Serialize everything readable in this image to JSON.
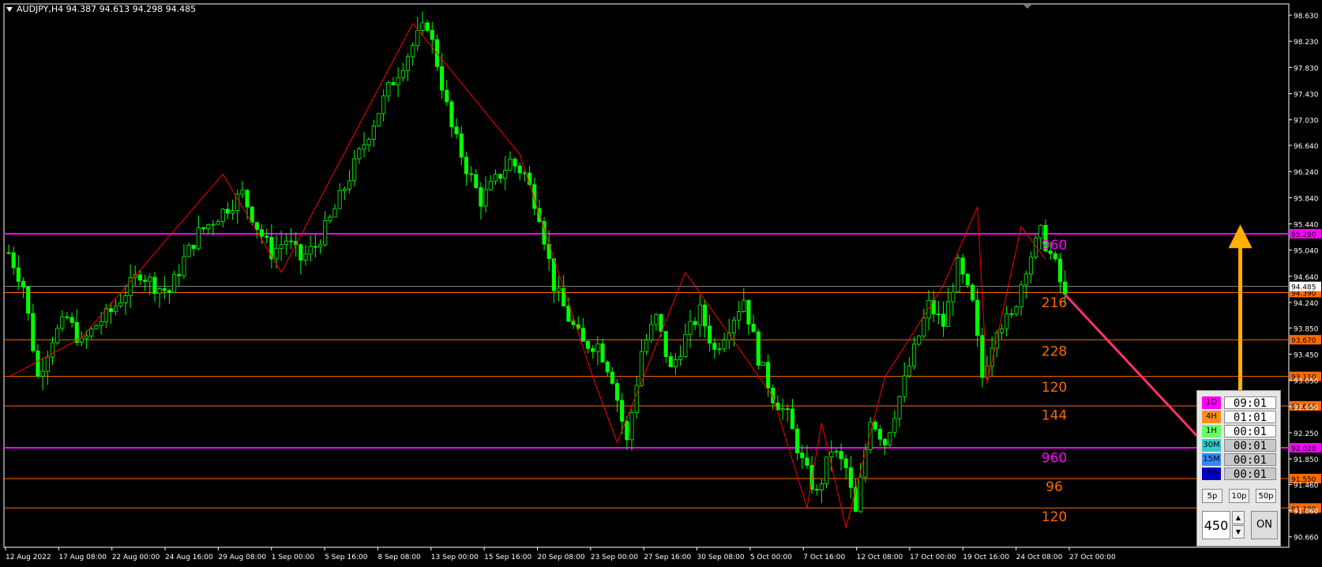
{
  "header": {
    "title": "AUDJPY,H4  94.387 94.613 94.298 94.485"
  },
  "colors": {
    "bull": "#00ff00",
    "bear": "#00ff00",
    "magenta": "#ff00ff",
    "orange": "#ff6a00",
    "zigzag": "#ff0000",
    "pink_arrow": "#ff3070",
    "gold_arrow": "#ffb000",
    "current": "#8a8a8a"
  },
  "chart_data": {
    "type": "candlestick",
    "symbol": "AUDJPY",
    "timeframe": "H4",
    "ylim": [
      90.5,
      98.8
    ],
    "y_ticks": [
      "98.630",
      "98.230",
      "97.830",
      "97.430",
      "97.030",
      "96.640",
      "96.240",
      "95.840",
      "95.440",
      "95.040",
      "94.640",
      "94.240",
      "93.850",
      "93.450",
      "93.050",
      "92.650",
      "92.250",
      "91.850",
      "91.460",
      "91.060",
      "90.660"
    ],
    "x_ticks": [
      "12 Aug 2022",
      "17 Aug 08:00",
      "22 Aug 00:00",
      "24 Aug 16:00",
      "29 Aug 08:00",
      "1 Sep 00:00",
      "5 Sep 16:00",
      "8 Sep 08:00",
      "13 Sep 00:00",
      "15 Sep 16:00",
      "20 Sep 08:00",
      "23 Sep 00:00",
      "27 Sep 16:00",
      "30 Sep 08:00",
      "5 Oct 00:00",
      "7 Oct 16:00",
      "12 Oct 08:00",
      "17 Oct 00:00",
      "19 Oct 16:00",
      "24 Oct 08:00",
      "27 Oct 00:00"
    ],
    "close_path": [
      [
        0,
        95.0
      ],
      [
        3,
        94.5
      ],
      [
        6,
        93.1
      ],
      [
        9,
        93.7
      ],
      [
        12,
        94.0
      ],
      [
        15,
        93.6
      ],
      [
        18,
        93.9
      ],
      [
        21,
        94.1
      ],
      [
        24,
        94.4
      ],
      [
        27,
        94.7
      ],
      [
        30,
        94.5
      ],
      [
        33,
        94.4
      ],
      [
        36,
        94.9
      ],
      [
        39,
        95.3
      ],
      [
        42,
        95.5
      ],
      [
        45,
        95.7
      ],
      [
        48,
        95.9
      ],
      [
        51,
        95.4
      ],
      [
        54,
        95.0
      ],
      [
        57,
        95.2
      ],
      [
        60,
        94.9
      ],
      [
        63,
        95.1
      ],
      [
        66,
        95.5
      ],
      [
        69,
        96.0
      ],
      [
        72,
        96.5
      ],
      [
        75,
        97.0
      ],
      [
        78,
        97.5
      ],
      [
        81,
        97.9
      ],
      [
        84,
        98.3
      ],
      [
        86,
        98.5
      ],
      [
        88,
        97.9
      ],
      [
        91,
        96.9
      ],
      [
        94,
        96.3
      ],
      [
        97,
        95.8
      ],
      [
        100,
        96.1
      ],
      [
        103,
        96.4
      ],
      [
        106,
        96.2
      ],
      [
        109,
        95.6
      ],
      [
        112,
        94.5
      ],
      [
        115,
        94.0
      ],
      [
        118,
        93.6
      ],
      [
        121,
        93.6
      ],
      [
        124,
        93.1
      ],
      [
        127,
        92.1
      ],
      [
        130,
        93.5
      ],
      [
        133,
        94.0
      ],
      [
        136,
        93.2
      ],
      [
        139,
        93.7
      ],
      [
        142,
        94.1
      ],
      [
        145,
        93.5
      ],
      [
        148,
        93.9
      ],
      [
        151,
        94.3
      ],
      [
        154,
        93.4
      ],
      [
        157,
        92.8
      ],
      [
        160,
        92.5
      ],
      [
        163,
        91.8
      ],
      [
        166,
        91.3
      ],
      [
        169,
        92.0
      ],
      [
        172,
        91.7
      ],
      [
        174,
        91.0
      ],
      [
        177,
        92.5
      ],
      [
        180,
        92.1
      ],
      [
        183,
        92.8
      ],
      [
        186,
        93.5
      ],
      [
        189,
        94.2
      ],
      [
        192,
        93.9
      ],
      [
        195,
        94.8
      ],
      [
        198,
        94.2
      ],
      [
        200,
        93.1
      ],
      [
        203,
        93.9
      ],
      [
        206,
        94.0
      ],
      [
        209,
        94.8
      ],
      [
        212,
        95.3
      ],
      [
        215,
        94.8
      ],
      [
        217,
        94.3
      ]
    ],
    "zigzag": [
      [
        0,
        93.1
      ],
      [
        15,
        93.7
      ],
      [
        44,
        96.2
      ],
      [
        56,
        94.7
      ],
      [
        83,
        98.5
      ],
      [
        105,
        96.5
      ],
      [
        120,
        93.1
      ],
      [
        125,
        92.1
      ],
      [
        139,
        94.7
      ],
      [
        157,
        92.8
      ],
      [
        164,
        91.1
      ],
      [
        167,
        92.4
      ],
      [
        172,
        90.8
      ],
      [
        180,
        93.1
      ],
      [
        192,
        94.5
      ],
      [
        199,
        95.7
      ],
      [
        201,
        93.0
      ],
      [
        208,
        95.4
      ],
      [
        213,
        94.9
      ]
    ],
    "levels": [
      {
        "price": 95.29,
        "label": "95.290",
        "color": "magenta"
      },
      {
        "price": 94.39,
        "label": "94.390",
        "color": "orange"
      },
      {
        "price": 93.67,
        "label": "93.670",
        "color": "orange"
      },
      {
        "price": 93.11,
        "label": "93.110",
        "color": "orange"
      },
      {
        "price": 92.66,
        "label": "92.660",
        "color": "orange"
      },
      {
        "price": 92.02,
        "label": "92.020",
        "color": "magenta"
      },
      {
        "price": 91.55,
        "label": "91.550",
        "color": "orange"
      },
      {
        "price": 91.1,
        "label": "91.100",
        "color": "orange"
      }
    ],
    "current_price": {
      "price": 94.485,
      "label": "94.485"
    },
    "level_annotations": [
      {
        "text": "960",
        "price": 95.12,
        "color": "magenta"
      },
      {
        "text": "216",
        "price": 94.24,
        "color": "orange"
      },
      {
        "text": "228",
        "price": 93.5,
        "color": "orange"
      },
      {
        "text": "120",
        "price": 92.95,
        "color": "orange"
      },
      {
        "text": "144",
        "price": 92.52,
        "color": "orange"
      },
      {
        "text": "960",
        "price": 91.87,
        "color": "magenta"
      },
      {
        "text": "96",
        "price": 91.43,
        "color": "orange"
      },
      {
        "text": "120",
        "price": 90.97,
        "color": "orange"
      }
    ],
    "arrows": [
      {
        "from": [
          217,
          94.36
        ],
        "to": [
          246,
          92.05
        ],
        "color": "pink_arrow",
        "heads": "end"
      },
      {
        "from": [
          253,
          95.25
        ],
        "to": [
          253,
          92.05
        ],
        "color": "gold_arrow",
        "heads": "both"
      }
    ]
  },
  "panel": {
    "timeframes": [
      {
        "tag": "1D",
        "time": "09:01",
        "color": "#ff00ff",
        "dim": false
      },
      {
        "tag": "4H",
        "time": "01:01",
        "color": "#ff8c1a",
        "dim": false
      },
      {
        "tag": "1H",
        "time": "00:01",
        "color": "#66ff66",
        "dim": false
      },
      {
        "tag": "30M",
        "time": "00:01",
        "color": "#33cccc",
        "dim": true
      },
      {
        "tag": "15M",
        "time": "00:01",
        "color": "#3388ff",
        "dim": true
      },
      {
        "tag": "5M",
        "time": "00:01",
        "color": "#0000cc",
        "dim": true
      }
    ],
    "buttons": [
      "5p",
      "10p",
      "50p"
    ],
    "value": "450",
    "on_label": "ON"
  }
}
